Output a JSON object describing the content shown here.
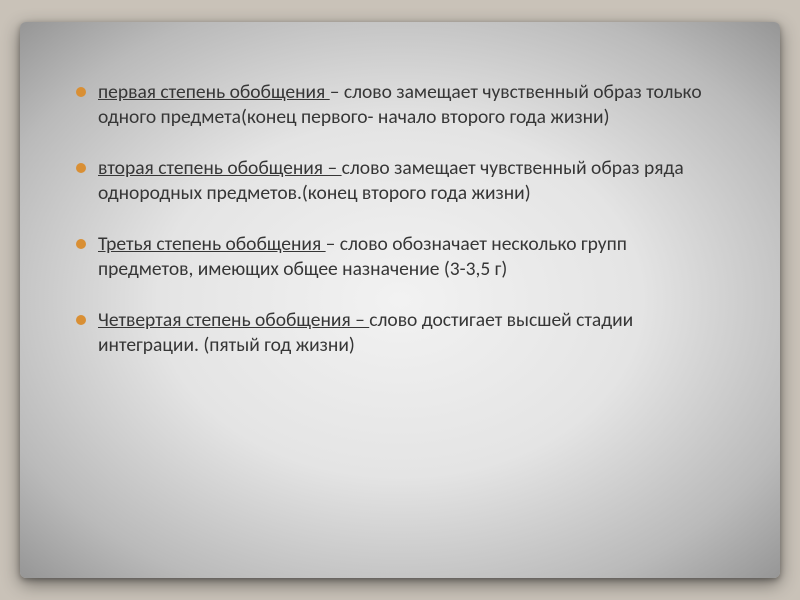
{
  "bullets": [
    {
      "title": "первая степень обобщения ",
      "rest": "– слово замещает чувственный образ только одного предмета(конец первого- начало второго года жизни)"
    },
    {
      "title": "вторая степень обобщения – ",
      "rest": "слово замещает чувственный образ ряда однородных предметов.(конец второго года жизни)"
    },
    {
      "title": "Третья степень  обобщения ",
      "rest": "– слово обозначает несколько групп предметов, имеющих общее назначение (3-3,5 г)"
    },
    {
      "title": "Четвертая степень обобщения – ",
      "rest": "слово достигает высшей стадии интеграции. (пятый год жизни)"
    }
  ]
}
